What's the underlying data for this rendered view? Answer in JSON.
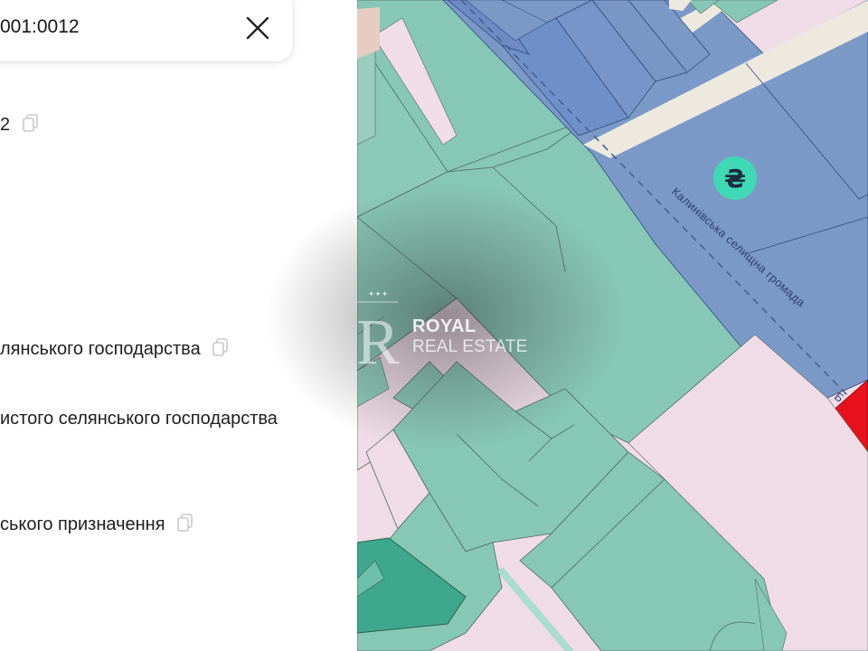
{
  "search": {
    "value": "001:0012"
  },
  "details": {
    "cadastral_fragment": "2",
    "purpose_line_1": "лянського господарства",
    "purpose_line_2": "истого селянського господарства",
    "category_line": "ського призначення"
  },
  "map": {
    "street_label": "Калинівська селищна громада",
    "currency_marker": "₴",
    "edge_label": "Б",
    "colors": {
      "agricultural_green": "#87c7b5",
      "residential_blue": "#7b99c7",
      "state_pink": "#efdce6",
      "highlight_red": "#e8101a"
    }
  },
  "watermark": {
    "monogram": "R",
    "brand": "ROYAL",
    "subtitle": "REAL ESTATE",
    "stars": "✦✦✦"
  }
}
